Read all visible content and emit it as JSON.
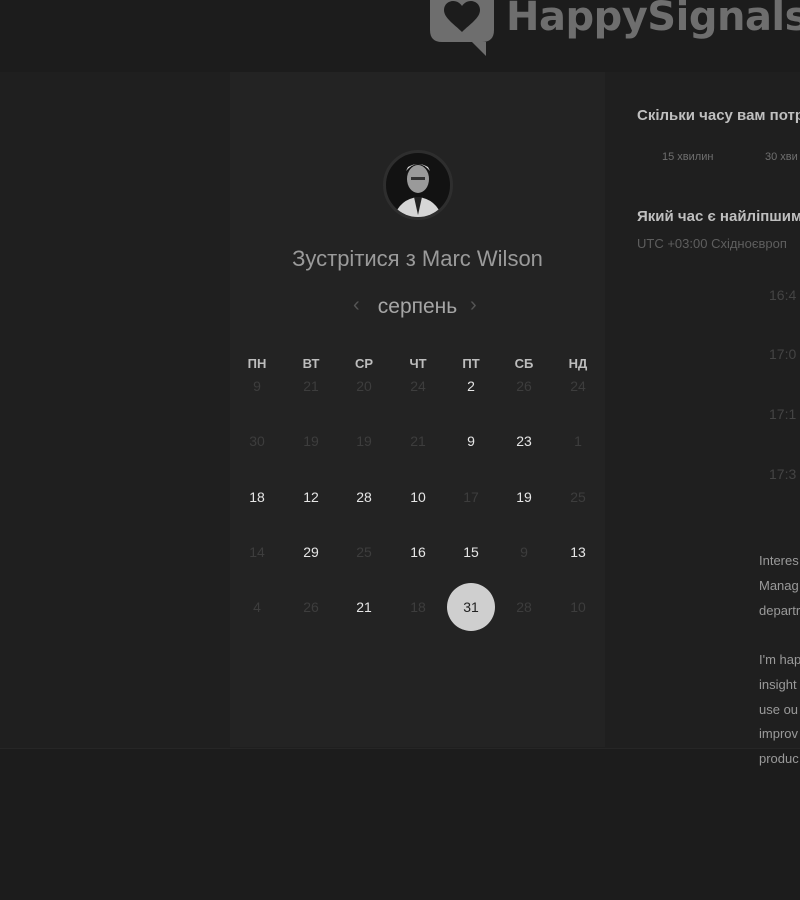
{
  "logo": {
    "brand_text": "HappySignals"
  },
  "card": {
    "meet_title": "Зустрітися з Marc Wilson",
    "month": "серпень",
    "prev_icon": "chevron-left-icon",
    "next_icon": "chevron-right-icon",
    "weekdays": [
      "ПН",
      "ВТ",
      "СР",
      "ЧТ",
      "ПТ",
      "СБ",
      "НД"
    ],
    "weeks": [
      [
        {
          "d": "9",
          "on": false
        },
        {
          "d": "21",
          "on": false
        },
        {
          "d": "20",
          "on": false
        },
        {
          "d": "24",
          "on": false
        },
        {
          "d": "2",
          "on": true
        },
        {
          "d": "26",
          "on": false
        },
        {
          "d": "24",
          "on": false
        }
      ],
      [
        {
          "d": "30",
          "on": false
        },
        {
          "d": "19",
          "on": false
        },
        {
          "d": "19",
          "on": false
        },
        {
          "d": "21",
          "on": false
        },
        {
          "d": "9",
          "on": true
        },
        {
          "d": "23",
          "on": true
        },
        {
          "d": "1",
          "on": false
        }
      ],
      [
        {
          "d": "18",
          "on": true
        },
        {
          "d": "12",
          "on": true
        },
        {
          "d": "28",
          "on": true
        },
        {
          "d": "10",
          "on": true
        },
        {
          "d": "17",
          "on": false
        },
        {
          "d": "19",
          "on": true
        },
        {
          "d": "25",
          "on": false
        }
      ],
      [
        {
          "d": "14",
          "on": false
        },
        {
          "d": "29",
          "on": true
        },
        {
          "d": "25",
          "on": false
        },
        {
          "d": "16",
          "on": true
        },
        {
          "d": "15",
          "on": true
        },
        {
          "d": "9",
          "on": false
        },
        {
          "d": "13",
          "on": true
        }
      ],
      [
        {
          "d": "4",
          "on": false
        },
        {
          "d": "26",
          "on": false
        },
        {
          "d": "21",
          "on": true
        },
        {
          "d": "18",
          "on": false
        },
        {
          "d": "31",
          "on": true,
          "selected": true
        },
        {
          "d": "28",
          "on": false
        },
        {
          "d": "10",
          "on": false
        }
      ]
    ]
  },
  "panel": {
    "q_duration": "Скільки часу вам потр",
    "durations": [
      "15 хвилин",
      "30 хви"
    ],
    "q_time": "Який час є найліпшим",
    "timezone": "UTC +03:00 Східноєвроп",
    "slots": [
      "16:4",
      "17:0",
      "17:1",
      "17:3"
    ],
    "desc_p1": [
      "Interes",
      "Manag",
      "departr"
    ],
    "desc_p2": [
      "I'm hap",
      "insight",
      "use ou",
      "improv",
      "produc"
    ]
  }
}
